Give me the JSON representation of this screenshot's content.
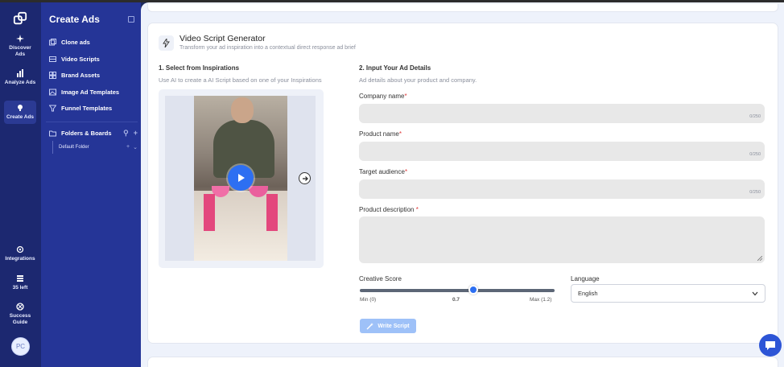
{
  "rail": {
    "items": [
      {
        "label": "Discover Ads",
        "icon": "sparkle-icon"
      },
      {
        "label": "Analyze Ads",
        "icon": "bar-chart-icon"
      },
      {
        "label": "Create Ads",
        "icon": "lightbulb-icon"
      }
    ],
    "bottom": [
      {
        "label": "Integrations",
        "icon": "gear-icon"
      },
      {
        "label": "35 left",
        "icon": "stack-icon"
      },
      {
        "label": "Success Guide",
        "icon": "lifebuoy-icon"
      }
    ],
    "avatar_initials": "PC"
  },
  "sidebar": {
    "title": "Create Ads",
    "items": [
      {
        "label": "Clone ads",
        "icon": "copy-icon"
      },
      {
        "label": "Video Scripts",
        "icon": "film-icon"
      },
      {
        "label": "Brand Assets",
        "icon": "palette-icon"
      },
      {
        "label": "Image Ad Templates",
        "icon": "image-icon"
      },
      {
        "label": "Funnel Templates",
        "icon": "funnel-icon"
      }
    ],
    "folders_label": "Folders & Boards",
    "default_folder": "Default Folder"
  },
  "generator": {
    "title": "Video Script Generator",
    "subtitle": "Transform your ad inspiration into a contextual direct response ad brief"
  },
  "section1": {
    "title": "1. Select from Inspirations",
    "subtitle": "Use AI to create a AI Script based on one of your Inspirations"
  },
  "section2": {
    "title": "2. Input Your Ad Details",
    "subtitle": "Ad details about your product and company."
  },
  "fields": {
    "company": {
      "label": "Company name",
      "required": "*",
      "count": "0/250"
    },
    "product": {
      "label": "Product name",
      "required": "*",
      "count": "0/250"
    },
    "audience": {
      "label": "Target audience",
      "required": "*",
      "count": "0/250"
    },
    "description": {
      "label": "Product description ",
      "required": "*"
    }
  },
  "creative_score": {
    "label": "Creative Score",
    "min_label": "Min (0)",
    "value_label": "0.7",
    "max_label": "Max (1.2)",
    "value": 0.7,
    "min": 0,
    "max": 1.2
  },
  "language": {
    "label": "Language",
    "selected": "English"
  },
  "write_button": "Write Script",
  "colors": {
    "rail": "#1c2870",
    "sidebar": "#253597",
    "accent": "#2d6ff2",
    "required": "#e03a3a"
  }
}
